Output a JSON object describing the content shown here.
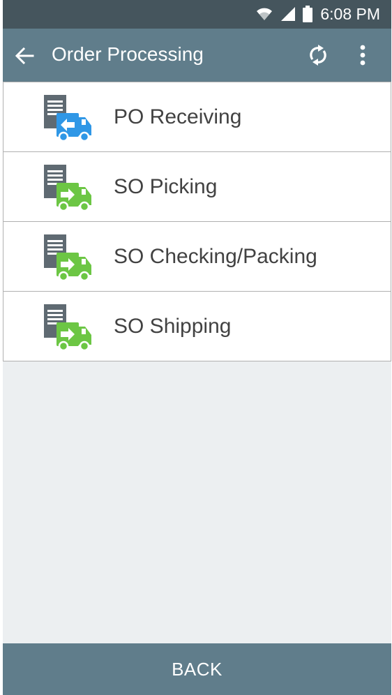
{
  "status_bar": {
    "time": "6:08 PM",
    "icons": [
      "wifi-icon",
      "signal-icon",
      "battery-icon"
    ]
  },
  "app_bar": {
    "title": "Order Processing",
    "back_icon": "arrow-left-icon",
    "actions": [
      "sync-icon",
      "more-vert-icon"
    ]
  },
  "menu": {
    "items": [
      {
        "label": "PO Receiving",
        "icon": "receiving-truck-icon",
        "truck_color": "#2f97e6",
        "direction": "in"
      },
      {
        "label": "SO Picking",
        "icon": "shipping-truck-icon",
        "truck_color": "#6cc644",
        "direction": "out"
      },
      {
        "label": "SO Checking/Packing",
        "icon": "shipping-truck-icon",
        "truck_color": "#6cc644",
        "direction": "out"
      },
      {
        "label": "SO Shipping",
        "icon": "shipping-truck-icon",
        "truck_color": "#6cc644",
        "direction": "out"
      }
    ]
  },
  "footer": {
    "back_label": "BACK"
  },
  "colors": {
    "status_bar": "#45555d",
    "app_bar": "#607d8b",
    "background": "#eceff1",
    "receiving": "#2f97e6",
    "shipping": "#6cc644"
  }
}
